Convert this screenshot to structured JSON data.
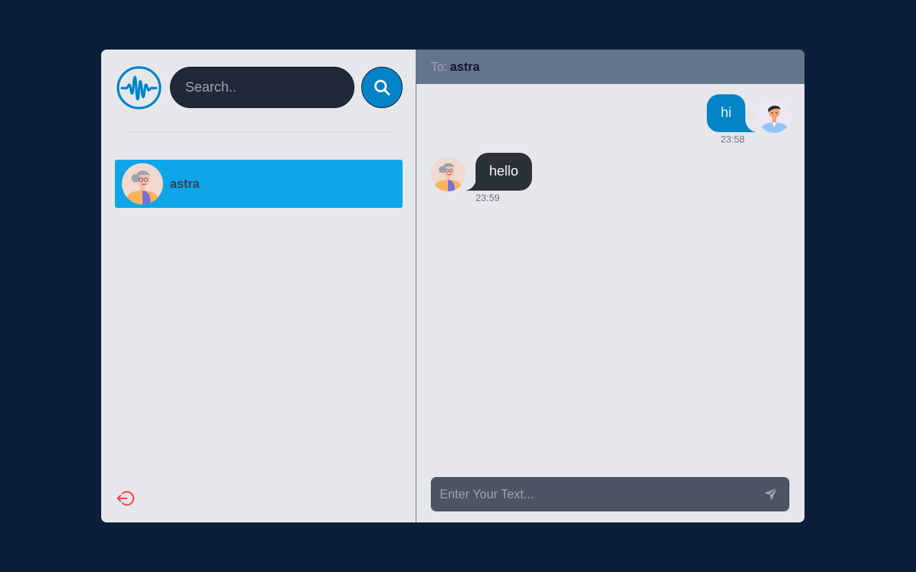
{
  "sidebar": {
    "logo_icon": "waveform-logo-icon",
    "search": {
      "placeholder": "Search..",
      "value": ""
    },
    "search_button_icon": "search-icon",
    "contacts": [
      {
        "name": "astra",
        "avatar": "old-woman-avatar",
        "selected": true
      }
    ],
    "logout_icon": "logout-icon"
  },
  "chat": {
    "header": {
      "to_label": "To:",
      "to_name": "astra"
    },
    "messages": [
      {
        "direction": "outgoing",
        "text": "hi",
        "time": "23:58",
        "avatar": "man-avatar"
      },
      {
        "direction": "incoming",
        "text": "hello",
        "time": "23:59",
        "avatar": "old-woman-avatar"
      }
    ],
    "composer": {
      "placeholder": "Enter Your Text...",
      "value": "",
      "send_icon": "send-icon"
    }
  },
  "colors": {
    "background": "#0a1d3a",
    "panel": "#e5e7eb",
    "accent": "#0284c7",
    "contact_selected": "#0ea5e9",
    "header": "#64748b",
    "incoming_bubble": "#2b3139",
    "logout": "#ef4444"
  }
}
